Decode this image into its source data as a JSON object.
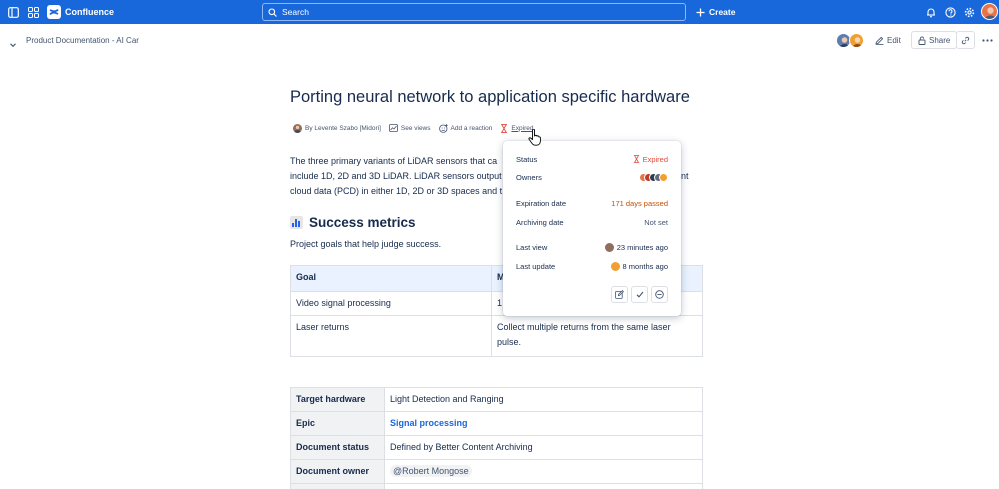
{
  "topnav": {
    "brand": "Confluence",
    "search_placeholder": "Search",
    "create_label": "Create",
    "colors": {
      "bar": "#1868DB"
    }
  },
  "breadcrumb": {
    "path": "Product Documentation - AI Car",
    "edit_label": "Edit",
    "share_label": "Share"
  },
  "page": {
    "title": "Porting neural network to application specific hardware",
    "byline": {
      "author": "By Levente Szabo [Midori]",
      "see_views": "See views",
      "add_reaction": "Add a reaction",
      "status": "Expired"
    },
    "intro_lines": [
      "The three primary variants of LiDAR sensors that ca",
      "include 1D, 2D and 3D LiDAR. LiDAR sensors output",
      "cloud data (PCD) in either 1D, 2D or 3D spaces and t"
    ],
    "intro_trailing": "nt",
    "section_heading": "Success metrics",
    "section_icon": "bar-chart-icon",
    "section_desc": "Project goals that help judge success.",
    "goals_table": {
      "headers": [
        "Goal",
        "M"
      ],
      "rows": [
        [
          "Video signal processing",
          "1"
        ],
        [
          "Laser returns",
          "Collect multiple returns from the same laser pulse."
        ]
      ]
    },
    "props_table": [
      {
        "key": "Target hardware",
        "value": "Light Detection and Ranging",
        "kind": "text"
      },
      {
        "key": "Epic",
        "value": "Signal processing",
        "kind": "link"
      },
      {
        "key": "Document status",
        "value": "Defined by Better Content Archiving",
        "kind": "text"
      },
      {
        "key": "Document owner",
        "value": "@Robert Mongose",
        "kind": "mention"
      }
    ]
  },
  "popup": {
    "status_label": "Status",
    "status_value": "Expired",
    "owners_label": "Owners",
    "expiration_label": "Expiration date",
    "expiration_value": "171 days passed",
    "archiving_label": "Archiving date",
    "archiving_value": "Not set",
    "last_view_label": "Last view",
    "last_view_value": "23 minutes ago",
    "last_update_label": "Last update",
    "last_update_value": "8 months ago",
    "colors": {
      "expired": "#E2483D",
      "expiration": "#C25100"
    }
  }
}
